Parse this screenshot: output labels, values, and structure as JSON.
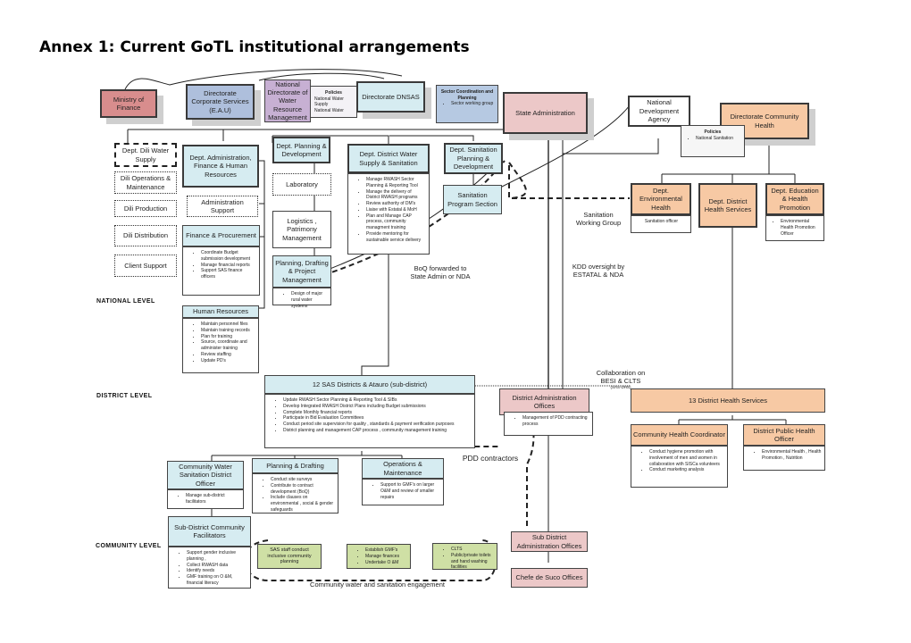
{
  "title": "Annex 1: Current GoTL institutional arrangements",
  "levels": {
    "national": "NATIONAL LEVEL",
    "district": "DISTRICT  LEVEL",
    "community": "COMMUNITY LEVEL"
  },
  "top": {
    "ministry_finance": "Ministry of Finance",
    "corporate_services": "Directorate Corporate Services (E.A.U)",
    "ndwrm": "National Directorate of Water Resource Management",
    "policies_water": {
      "title": "Policies",
      "items": [
        "National Water Supply",
        "National Water"
      ]
    },
    "dnsas": "Directorate DNSAS",
    "sector_coord": {
      "title": "Sector Coordination and Planning",
      "items": [
        "Sector working group"
      ]
    },
    "state_admin": "State Administration",
    "nda": "National Development Agency",
    "community_health": "Directorate Community Health",
    "policies_sanitation": {
      "title": "Policies",
      "items": [
        "National Sanitation"
      ]
    }
  },
  "dili": {
    "water_supply": "Dept. Dili Water Supply",
    "operations": "Dili Operations & Maintenance",
    "production": "Dili Production",
    "distribution": "Dili Distribution",
    "client_support": "Client Support"
  },
  "admin": {
    "dept": "Dept. Administration, Finance & Human Resources",
    "admin_support": "Administration Support",
    "finance": {
      "title": "Finance & Procurement",
      "items": [
        "Coordinate Budget submission development",
        "Manage financial reports",
        "Support SAS finance officers"
      ]
    },
    "hr": {
      "title": "Human Resources",
      "items": [
        "Maintain personnel files",
        "Maintain training records",
        "Plan for training",
        "Source, coordinate and administer training",
        "Review staffing",
        "Update PD's"
      ]
    }
  },
  "planning": {
    "dept": "Dept. Planning & Development",
    "laboratory": "Laboratory",
    "logistics": "Logistics , Patrimony Management",
    "pdpm": {
      "title": "Planning, Drafting & Project Management",
      "items": [
        "Design of major rural water systems"
      ]
    }
  },
  "district_ws": {
    "title": "Dept. District Water Supply & Sanitation",
    "items": [
      "Manage RWASH Sector Planning & Reporting Tool",
      "Manage the delivery of District RWASH programs",
      "Review authority of DM's",
      "Liaise with Estatal & MoH",
      "Plan and Manage CAP process, community managment training",
      "Provide mentoring for sustainable service delivery"
    ]
  },
  "sanitation": {
    "dept": "Dept. Sanitation Planning & Development",
    "program": "Sanitation Program Section"
  },
  "health": {
    "env": {
      "title": "Dept. Environmental Health",
      "items": [
        "Sanitation officer"
      ]
    },
    "district": "Dept. District Health Services",
    "education": {
      "title": "Dept. Education & Health Promotion",
      "items": [
        "Environmental Health Promotion Officer"
      ]
    }
  },
  "notes": {
    "sanitation_wg": "Sanitation Working Group",
    "boq": "BoQ forwarded to State Admin or NDA",
    "kdd": "KDD oversight by ESTATAL & NDA",
    "collab": "Collaboration on BESI & CLTS",
    "collab_sub": "(SAS-DHS)",
    "pdd": "PDD contractors",
    "engagement": "Community water and sanitation engagement"
  },
  "district": {
    "sas": {
      "title": "12 SAS Districts & Atauro (sub-district)",
      "items": [
        "Update RWASH Sector Planning & Reporting Tool & SIBs",
        "Develop Integrated RWASH District Plans including Budget submissions",
        "Complete Monthly financial reports",
        "Participate in Bid Evaluation Committees",
        "Conduct period site supervision for quality , standards & payment verification purposes",
        "District planning and management CAP process , community management training"
      ]
    },
    "dao": {
      "title": "District Administration Offices",
      "items": [
        "Management of PDD contracting process"
      ]
    },
    "dhs13": "13 District Health Services",
    "chc": {
      "title": "Community Health Coordinator",
      "items": [
        "Conduct hygiene promotion with involvement of men and women in collaboration with SISCa volunteers",
        "Conduct marketing analysis"
      ]
    },
    "dpho": {
      "title": "District Public Health Officer",
      "items": [
        "Environmental Health , Health Promotion , Nutrition"
      ]
    },
    "cwsdo": {
      "title": "Community Water Sanitation District Officer",
      "items": [
        "Manage sub-district facilitators"
      ]
    },
    "pd": {
      "title": "Planning & Drafting",
      "items": [
        "Conduct site surveys",
        "Contribute to contract development (BoQ)",
        "Include clauses on environmental , social & gender safeguards"
      ]
    },
    "om": {
      "title": "Operations & Maintenance",
      "items": [
        "Support to GMF's on larger O&M and review of smaller repairs"
      ]
    }
  },
  "community": {
    "sdcf": {
      "title": "Sub-District Community Facilitators",
      "items": [
        "Support gender inclusive planning ,",
        "Collect RWASH data",
        "Identify needs",
        "GMF training on O &M, financial literacy"
      ]
    },
    "g1": "SAS staff conduct inclusive community planning",
    "g2": [
      "Establish GMF's",
      "Manage finances",
      "Undertake O &M"
    ],
    "g3": [
      "CLTS",
      "Public/private toilets and hand washing facilities"
    ],
    "sub_dao": "Sub District Administration Offices",
    "chefe": "Chefe de Suco Offices"
  }
}
